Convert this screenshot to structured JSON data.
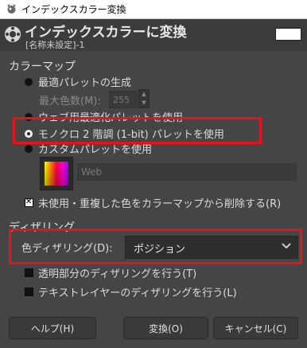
{
  "window": {
    "title": "インデックスカラー変換"
  },
  "header": {
    "title": "インデックスカラーに変換",
    "subtitle": "[名称未設定]-1",
    "preview_color": "#ffffff"
  },
  "colormap": {
    "section_label": "カラーマップ",
    "opt_optimal": "最適パレットの生成",
    "max_colors_label": "最大色数(M):",
    "max_colors_value": "255",
    "opt_web": "ウェブ用最適化パレットを使用",
    "opt_mono": "モノクロ 2 階調 (1-bit) パレットを使用",
    "opt_custom": "カスタムパレットを使用",
    "palette_name": "Web",
    "remove_unused": "未使用・重複した色をカラーマップから削除する(R)"
  },
  "dithering": {
    "section_label": "ディザリング",
    "color_dither_label": "色ディザリング(D):",
    "color_dither_value": "ポジション",
    "transparency": "透明部分のディザリングを行う(T)",
    "text_layers": "テキストレイヤーのディザリングを行う(L)"
  },
  "buttons": {
    "help": "ヘルプ(H)",
    "convert": "変換(O)",
    "cancel": "キャンセル(C)"
  },
  "colors": {
    "accent_highlight": "#e3141b",
    "background": "#454545"
  },
  "icons": {
    "title_icon": "gimp-icon",
    "header_icon": "convert-indexed-icon",
    "dropdown": "chevron-down-icon"
  }
}
